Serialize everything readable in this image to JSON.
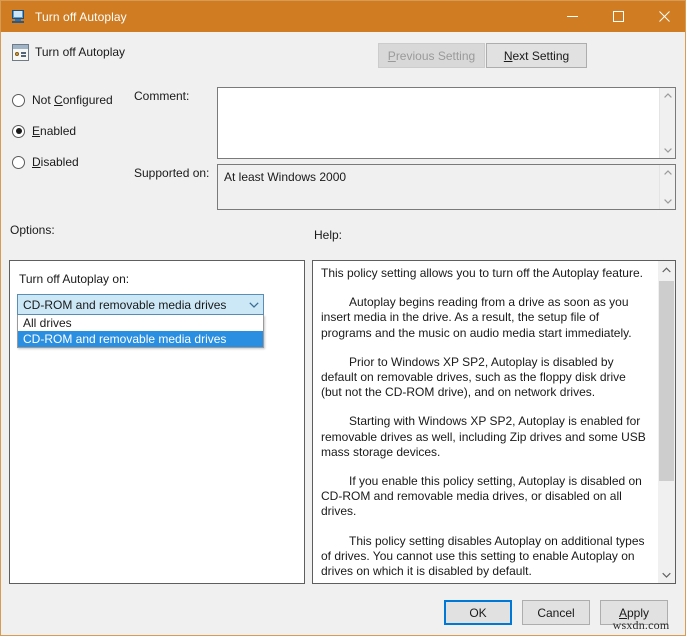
{
  "window": {
    "title": "Turn off Autoplay",
    "title_icon": "policy-monitor-icon",
    "accent_color": "#cf7c22",
    "minimize_label": "Minimize",
    "maximize_label": "Maximize",
    "close_label": "Close"
  },
  "header": {
    "policy_name": "Turn off Autoplay",
    "policy_icon": "policy-setting-icon",
    "previous_setting": {
      "label": "Previous Setting",
      "accelerator": "P",
      "enabled": false
    },
    "next_setting": {
      "label": "Next Setting",
      "accelerator": "N",
      "enabled": true
    }
  },
  "state_options": [
    {
      "label": "Not Configured",
      "accelerator": "C",
      "selected": false
    },
    {
      "label": "Enabled",
      "accelerator": "E",
      "selected": true
    },
    {
      "label": "Disabled",
      "accelerator": "D",
      "selected": false
    }
  ],
  "comment": {
    "label": "Comment:",
    "value": "",
    "scrollbar": true
  },
  "supported_on": {
    "label": "Supported on:",
    "value": "At least Windows 2000",
    "readonly": true,
    "scrollbar": true
  },
  "sections": {
    "options_label": "Options:",
    "help_label": "Help:"
  },
  "options": {
    "combo_label": "Turn off Autoplay on:",
    "selected_value": "CD-ROM and removable media drives",
    "expanded": true,
    "items": [
      {
        "label": "All drives",
        "selected": false
      },
      {
        "label": "CD-ROM and removable media drives",
        "selected": true
      }
    ],
    "highlight_color": "#2a8fe0",
    "field_color": "#cce8f7"
  },
  "help": {
    "paragraphs": [
      "This policy setting allows you to turn off the Autoplay feature.",
      "Autoplay begins reading from a drive as soon as you insert media in the drive. As a result, the setup file of programs and the music on audio media start immediately.",
      "Prior to Windows XP SP2, Autoplay is disabled by default on removable drives, such as the floppy disk drive (but not the CD-ROM drive), and on network drives.",
      "Starting with Windows XP SP2, Autoplay is enabled for removable drives as well, including Zip drives and some USB mass storage devices.",
      "If you enable this policy setting, Autoplay is disabled on CD-ROM and removable media drives, or disabled on all drives.",
      "This policy setting disables Autoplay on additional types of drives. You cannot use this setting to enable Autoplay on drives on which it is disabled by default."
    ]
  },
  "footer": {
    "ok": "OK",
    "cancel": "Cancel",
    "apply": "Apply",
    "apply_accelerator": "A",
    "default_button": "OK"
  },
  "watermark": "wsxdn.com"
}
